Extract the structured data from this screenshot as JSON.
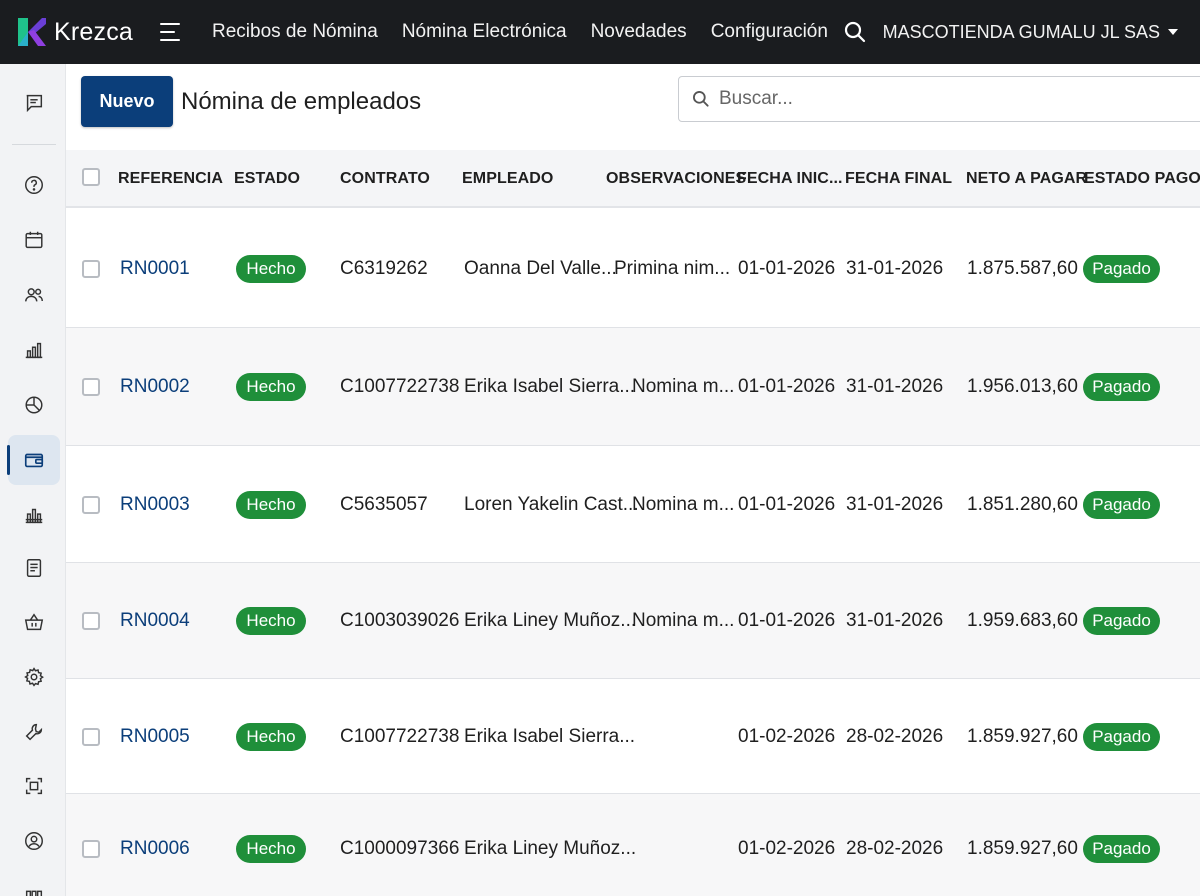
{
  "app": {
    "brand": "Krezca",
    "company": "MASCOTIENDA GUMALU JL SAS",
    "colors": {
      "primary": "#0b3e7a",
      "topbar": "#1a1c1f",
      "success": "#1f8f3a"
    }
  },
  "nav": {
    "items": [
      {
        "label": "Recibos de Nómina"
      },
      {
        "label": "Nómina Electrónica"
      },
      {
        "label": "Novedades"
      },
      {
        "label": "Configuración"
      }
    ]
  },
  "sidebar": {
    "items": [
      {
        "icon": "chat-icon"
      },
      {
        "icon": "help-icon"
      },
      {
        "icon": "calendar-icon"
      },
      {
        "icon": "users-icon"
      },
      {
        "icon": "bar-chart-icon"
      },
      {
        "icon": "pie-chart-icon"
      },
      {
        "icon": "wallet-icon",
        "active": true
      },
      {
        "icon": "bank-icon"
      },
      {
        "icon": "document-icon"
      },
      {
        "icon": "basket-icon"
      },
      {
        "icon": "gear-icon"
      },
      {
        "icon": "wrench-icon"
      },
      {
        "icon": "scan-icon"
      },
      {
        "icon": "user-circle-icon"
      },
      {
        "icon": "more-icon"
      }
    ]
  },
  "header": {
    "new_label": "Nuevo",
    "title": "Nómina de empleados",
    "search_placeholder": "Buscar..."
  },
  "table": {
    "columns": [
      "REFERENCIA",
      "ESTADO",
      "CONTRATO",
      "EMPLEADO",
      "OBSERVACIONES",
      "FECHA INIC...",
      "FECHA FINAL",
      "NETO A PAGAR",
      "ESTADO PAGO"
    ],
    "rows": [
      {
        "ref": "RN0001",
        "estado": "Hecho",
        "contrato": "C6319262",
        "empleado": "Oanna Del Valle...",
        "obs": "Primina nim...",
        "inicio": "01-01-2026",
        "final": "31-01-2026",
        "neto": "1.875.587,60",
        "pago": "Pagado"
      },
      {
        "ref": "RN0002",
        "estado": "Hecho",
        "contrato": "C1007722738",
        "empleado": "Erika Isabel Sierra...",
        "obs": "Nomina m...",
        "inicio": "01-01-2026",
        "final": "31-01-2026",
        "neto": "1.956.013,60",
        "pago": "Pagado"
      },
      {
        "ref": "RN0003",
        "estado": "Hecho",
        "contrato": "C5635057",
        "empleado": "Loren Yakelin Cast...",
        "obs": "Nomina m...",
        "inicio": "01-01-2026",
        "final": "31-01-2026",
        "neto": "1.851.280,60",
        "pago": "Pagado"
      },
      {
        "ref": "RN0004",
        "estado": "Hecho",
        "contrato": "C1003039026",
        "empleado": "Erika Liney Muñoz...",
        "obs": "Nomina m...",
        "inicio": "01-01-2026",
        "final": "31-01-2026",
        "neto": "1.959.683,60",
        "pago": "Pagado"
      },
      {
        "ref": "RN0005",
        "estado": "Hecho",
        "contrato": "C1007722738",
        "empleado": "Erika Isabel Sierra...",
        "obs": "",
        "inicio": "01-02-2026",
        "final": "28-02-2026",
        "neto": "1.859.927,60",
        "pago": "Pagado"
      },
      {
        "ref": "RN0006",
        "estado": "Hecho",
        "contrato": "C1000097366",
        "empleado": "Erika Liney Muñoz...",
        "obs": "",
        "inicio": "01-02-2026",
        "final": "28-02-2026",
        "neto": "1.859.927,60",
        "pago": "Pagado"
      }
    ]
  }
}
